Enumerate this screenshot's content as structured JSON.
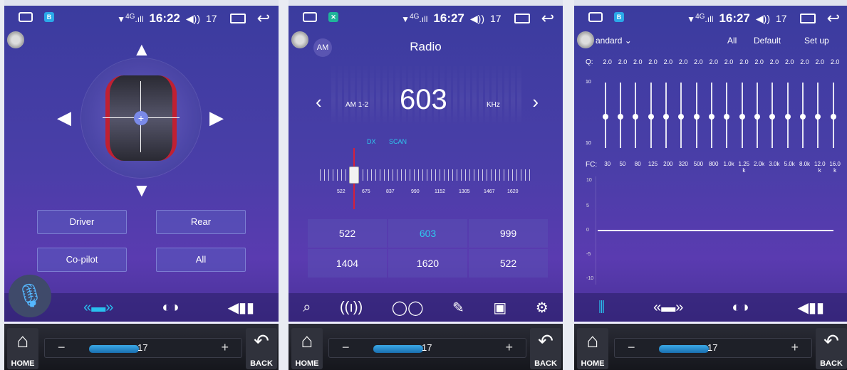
{
  "status": {
    "time1": "16:22",
    "time2": "16:27",
    "time3": "16:27",
    "volume": "17",
    "signal": "4G"
  },
  "colors": {
    "accent": "#2ec9ee",
    "tuner_needle": "#d6203a"
  },
  "seat": {
    "buttons": [
      "Driver",
      "Rear",
      "Co-pilot",
      "All"
    ]
  },
  "radio": {
    "am_label": "AM",
    "title": "Radio",
    "band": "AM 1-2",
    "frequency": "603",
    "unit": "KHz",
    "dx": "DX",
    "scan": "SCAN",
    "ticks": [
      "522",
      "675",
      "837",
      "990",
      "1152",
      "1305",
      "1467",
      "1620"
    ],
    "presets": [
      "522",
      "603",
      "999",
      "1404",
      "1620",
      "522"
    ],
    "active_preset_index": 1
  },
  "eq": {
    "preset": "andard",
    "all": "All",
    "default": "Default",
    "setup": "Set up",
    "q_label": "Q:",
    "q_values": [
      "2.0",
      "2.0",
      "2.0",
      "2.0",
      "2.0",
      "2.0",
      "2.0",
      "2.0",
      "2.0",
      "2.0",
      "2.0",
      "2.0",
      "2.0",
      "2.0",
      "2.0",
      "2.0"
    ],
    "slider_top": "10",
    "slider_bottom": "10",
    "fc_label": "FC:",
    "fc_values": [
      "30",
      "50",
      "80",
      "125",
      "200",
      "320",
      "500",
      "800",
      "1.0k",
      "1.25 k",
      "2.0k",
      "3.0k",
      "5.0k",
      "8.0k",
      "12.0 k",
      "16.0 k"
    ],
    "graph_labels": [
      "10",
      "5",
      "0",
      "-5",
      "-10"
    ]
  },
  "dock": {
    "home": "HOME",
    "back": "BACK",
    "minus": "−",
    "plus": "+",
    "volume": "17"
  }
}
